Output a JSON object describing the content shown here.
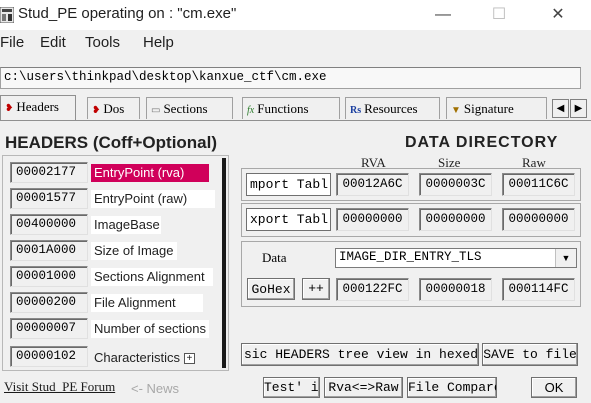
{
  "window": {
    "title": "Stud_PE operating on : \"cm.exe\"",
    "minimize": "—",
    "maximize": "☐",
    "close": "✕"
  },
  "menu": [
    "File",
    "Edit",
    "Tools",
    "Help"
  ],
  "file_path": "c:\\users\\thinkpad\\desktop\\kanxue_ctf\\cm.exe",
  "tabs": [
    {
      "label": "Headers",
      "icon": "headers-icon",
      "active": true
    },
    {
      "label": "Dos",
      "icon": "dos-icon",
      "active": false
    },
    {
      "label": "Sections",
      "icon": "sections-icon",
      "active": false
    },
    {
      "label": "Functions",
      "icon": "functions-icon",
      "active": false
    },
    {
      "label": "Resources",
      "icon": "resources-icon",
      "active": false
    },
    {
      "label": "Signature",
      "icon": "signature-icon",
      "active": false
    }
  ],
  "tab_scroll": {
    "left": "◀",
    "right": "▶"
  },
  "headers": {
    "title": "HEADERS (Coff+Optional)",
    "fields": [
      {
        "value": "00002177",
        "label": "EntryPoint (rva)",
        "style": "highlight"
      },
      {
        "value": "00001577",
        "label": "EntryPoint (raw)",
        "style": "white"
      },
      {
        "value": "00400000",
        "label": "ImageBase",
        "style": "white"
      },
      {
        "value": "0001A000",
        "label": "Size of Image",
        "style": "white"
      },
      {
        "value": "00001000",
        "label": "Sections Alignment",
        "style": "white"
      },
      {
        "value": "00000200",
        "label": "File Alignment",
        "style": "white"
      },
      {
        "value": "00000007",
        "label": "Number of sections",
        "style": "white"
      },
      {
        "value": "00000102",
        "label": "Characteristics",
        "style": "plain",
        "expand": "+"
      }
    ]
  },
  "data_directory": {
    "title": "DATA DIRECTORY",
    "columns": [
      "RVA",
      "Size",
      "Raw"
    ],
    "rows": [
      {
        "name": "Import Table",
        "shown": "mport Tabl",
        "rva": "00012A6C",
        "size": "0000003C",
        "raw": "00011C6C"
      },
      {
        "name": "Export Table",
        "shown": "xport Tabl",
        "rva": "00000000",
        "size": "00000000",
        "raw": "00000000"
      }
    ],
    "data_label": "Data",
    "selected_dir": "IMAGE_DIR_ENTRY_TLS",
    "gohex_label": "GoHex",
    "plus_label": "++",
    "data_rva": "000122FC",
    "data_size": "00000018",
    "data_raw": "000114FC",
    "tree_view_label": "sic HEADERS tree view in hexedi",
    "save_label": "SAVE to file"
  },
  "bottom": {
    "visit_link": "Visit Stud_PE Forum",
    "news_label": "<- News",
    "test_label": "Test' it",
    "rva_raw_label": "Rva<=>Raw",
    "file_compare_label": "File Compare",
    "ok_label": "OK"
  }
}
